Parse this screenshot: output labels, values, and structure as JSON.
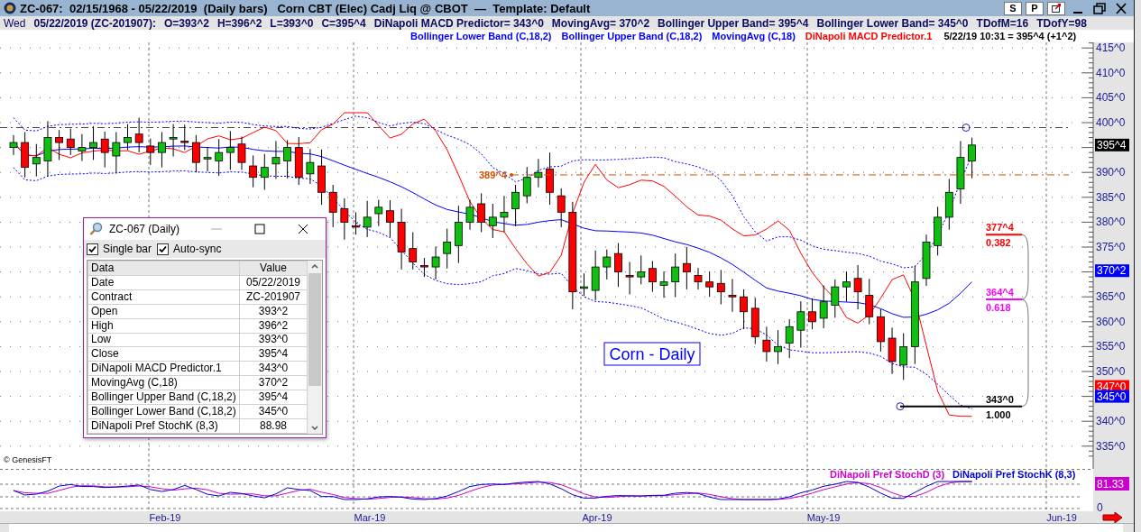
{
  "window": {
    "title": "ZC-067:  02/15/1968 - 05/22/2019  (Daily bars)   Corn CBT (Elec) Cadj Liq @ CBOT  —  Template: Default",
    "buttons": [
      "S",
      "P"
    ]
  },
  "info_bar": {
    "day": "Wed",
    "items": [
      "05/22/2019 (ZC-201907):",
      "O=393^2",
      "H=396^2",
      "L=393^0",
      "C=395^4",
      "DiNapoli MACD Predictor= 343^0",
      "MovingAvg= 370^2",
      "Bollinger Upper Band= 395^4",
      "Bollinger Lower Band= 345^0",
      "TDofM=16",
      "TDofY=98"
    ]
  },
  "legend": [
    {
      "label": "Bollinger Lower Band (C,18,2)",
      "color": "#0000ff"
    },
    {
      "label": "Bollinger Upper Band (C,18,2)",
      "color": "#0000ff"
    },
    {
      "label": "MovingAvg (C,18)",
      "color": "#0000ff"
    },
    {
      "label": "DiNapoli MACD Predictor.1",
      "color": "#ff0000"
    }
  ],
  "last_update": "5/22/19 10:31 = 395^4 (+1^2)",
  "price_axis": [
    "415^0",
    "410^0",
    "405^0",
    "400^0",
    "390^0",
    "385^0",
    "380^0",
    "375^0",
    "365^0",
    "360^0",
    "355^0",
    "350^0",
    "340^0",
    "335^0"
  ],
  "price_markers": [
    {
      "label": "395^4",
      "color": "#000000"
    },
    {
      "label": "370^2",
      "color": "#0000ff"
    },
    {
      "label": "347^0",
      "color": "#ff0000"
    },
    {
      "label": "345^0",
      "color": "#0000ff"
    }
  ],
  "level_label": {
    "text": "389^4",
    "color": "#d05000"
  },
  "fib_levels": [
    {
      "price": "377^4",
      "ratio": "0.382",
      "color": "#ff0000"
    },
    {
      "price": "364^4",
      "ratio": "0.618",
      "color": "#ff00ff"
    },
    {
      "price": "343^0",
      "ratio": "1.000",
      "color": "#000000"
    }
  ],
  "chart_label": "Corn - Daily",
  "copyright": "© GenesisFT",
  "sub_legend": [
    {
      "label": "DiNapoli Pref StochD (3)",
      "color": "#cc00cc"
    },
    {
      "label": "DiNapoli Pref StochK (8,3)",
      "color": "#0000cc"
    }
  ],
  "sub_axis": {
    "marker": "81.33",
    "zero": "0"
  },
  "time_axis": [
    "Feb-19",
    "Mar-19",
    "Apr-19",
    "May-19",
    "Jun-19"
  ],
  "data_window": {
    "title": "ZC-067 (Daily)",
    "options": [
      {
        "label": "Single bar",
        "checked": true
      },
      {
        "label": "Auto-sync",
        "checked": true
      }
    ],
    "columns": [
      "Data",
      "Value"
    ],
    "rows": [
      [
        "Date",
        "05/22/2019"
      ],
      [
        "Contract",
        "ZC-201907"
      ],
      [
        "Open",
        "393^2"
      ],
      [
        "High",
        "396^2"
      ],
      [
        "Low",
        "393^0"
      ],
      [
        "Close",
        "395^4"
      ],
      [
        "DiNapoli MACD Predictor.1",
        "343^0"
      ],
      [
        "MovingAvg (C,18)",
        "370^2"
      ],
      [
        "Bollinger Upper Band (C,18,2)",
        "395^4"
      ],
      [
        "Bollinger Lower Band (C,18,2)",
        "345^0"
      ],
      [
        "DiNapoli Pref StochK (8,3)",
        "88.98"
      ]
    ]
  }
}
